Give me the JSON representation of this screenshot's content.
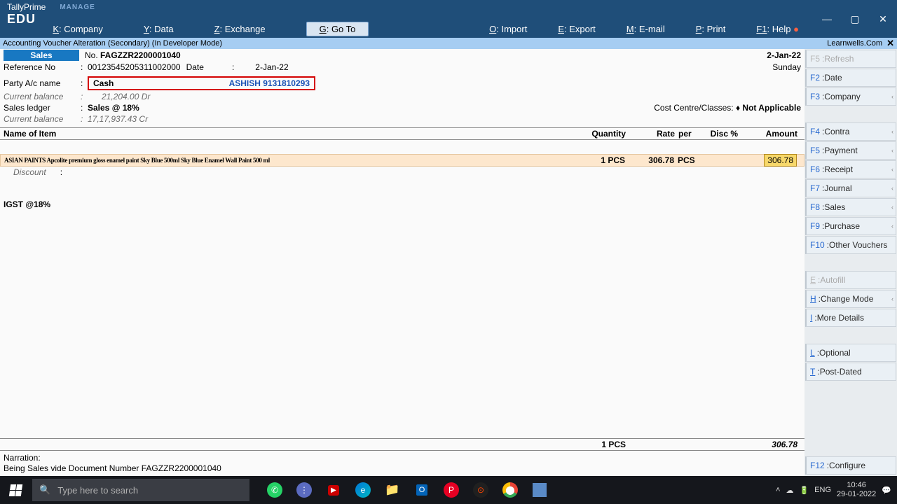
{
  "titlebar": {
    "app": "TallyPrime",
    "edu": "EDU",
    "manage": "MANAGE"
  },
  "winbtns": {
    "min": "—",
    "max": "▢",
    "close": "✕"
  },
  "topmenu": {
    "company": {
      "key": "K",
      "label": "Company"
    },
    "data": {
      "key": "Y",
      "label": "Data"
    },
    "exchange": {
      "key": "Z",
      "label": "Exchange"
    },
    "goto": {
      "key": "G",
      "label": "Go To"
    },
    "import": {
      "key": "O",
      "label": "Import"
    },
    "export": {
      "key": "E",
      "label": "Export"
    },
    "email": {
      "key": "M",
      "label": "E-mail"
    },
    "print": {
      "key": "P",
      "label": "Print"
    },
    "help": {
      "key": "F1",
      "label": "Help"
    }
  },
  "breadcrumb": {
    "left": "Accounting Voucher Alteration (Secondary) (In Developer Mode)",
    "right": "Learnwells.Com"
  },
  "rightpanel": {
    "refresh": {
      "key": "F5",
      "label": "Refresh"
    },
    "date": {
      "key": "F2",
      "label": "Date"
    },
    "company": {
      "key": "F3",
      "label": "Company"
    },
    "contra": {
      "key": "F4",
      "label": "Contra"
    },
    "payment": {
      "key": "F5",
      "label": "Payment"
    },
    "receipt": {
      "key": "F6",
      "label": "Receipt"
    },
    "journal": {
      "key": "F7",
      "label": "Journal"
    },
    "sales": {
      "key": "F8",
      "label": "Sales"
    },
    "purchase": {
      "key": "F9",
      "label": "Purchase"
    },
    "other": {
      "key": "F10",
      "label": "Other Vouchers"
    },
    "autofill": {
      "key": "E",
      "label": "Autofill"
    },
    "mode": {
      "key": "H",
      "label": "Change Mode"
    },
    "details": {
      "key": "I",
      "label": "More Details"
    },
    "optional": {
      "key": "L",
      "label": "Optional"
    },
    "postdated": {
      "key": "T",
      "label": "Post-Dated"
    },
    "configure": {
      "key": "F12",
      "label": "Configure"
    }
  },
  "voucher": {
    "saleslbl": "Sales",
    "nolbl": "No.",
    "vno": "FAGZZR2200001040",
    "datehdr": "2-Jan-22",
    "dayhdr": "Sunday",
    "reflbl": "Reference No",
    "refno": "00123545205311002000",
    "datelbl": "Date",
    "refdate": "2-Jan-22",
    "partylbl": "Party A/c name",
    "partycash": "Cash",
    "partyname": "ASHISH 9131810293",
    "curbal_lbl": "Current balance",
    "party_bal": "21,204.00 Dr",
    "salesledger_lbl": "Sales ledger",
    "salesledger": "Sales @ 18%",
    "sales_bal": "17,17,937.43 Cr",
    "costcentre_lbl": "Cost Centre/Classes:",
    "costcentre_val": "♦ Not Applicable",
    "thead": {
      "item": "Name of Item",
      "qty": "Quantity",
      "rate": "Rate",
      "per": "per",
      "disc": "Disc %",
      "amt": "Amount"
    },
    "line": {
      "desc": "ASIAN PAINTS Apcolite premium gloss enamel paint Sky Blue 500ml Sky Blue Enamel Wall Paint 500 ml",
      "qty": "1 PCS",
      "rate": "306.78",
      "per": "PCS",
      "amt": "306.78"
    },
    "discount_lbl": "Discount",
    "igst_lbl": "IGST @18%",
    "total_qty": "1 PCS",
    "total_amt": "306.78",
    "narration_lbl": "Narration:",
    "narration": "Being Sales vide Document Number FAGZZR2200001040"
  },
  "taskbar": {
    "search_placeholder": "Type here to search",
    "lang": "ENG",
    "time": "10:46",
    "date": "29-01-2022"
  }
}
